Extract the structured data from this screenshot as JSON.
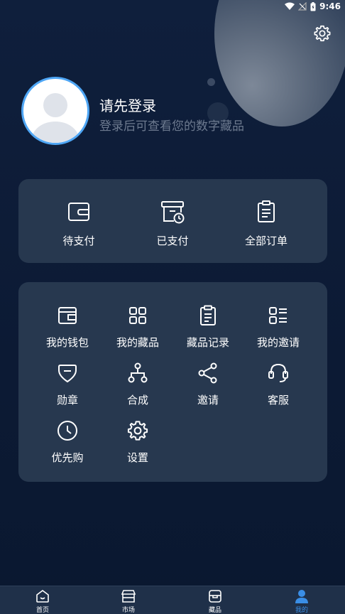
{
  "status_bar": {
    "time": "9:46"
  },
  "profile": {
    "login_title": "请先登录",
    "login_subtitle": "登录后可查看您的数字藏品"
  },
  "orders": [
    {
      "label": "待支付",
      "icon": "wallet-icon"
    },
    {
      "label": "已支付",
      "icon": "box-clock-icon"
    },
    {
      "label": "全部订单",
      "icon": "clipboard-icon"
    }
  ],
  "menu": [
    {
      "label": "我的钱包",
      "icon": "wallet-icon"
    },
    {
      "label": "我的藏品",
      "icon": "grid-icon"
    },
    {
      "label": "藏品记录",
      "icon": "clipboard-icon"
    },
    {
      "label": "我的邀请",
      "icon": "list-icon"
    },
    {
      "label": "勋章",
      "icon": "badge-icon"
    },
    {
      "label": "合成",
      "icon": "hierarchy-icon"
    },
    {
      "label": "邀请",
      "icon": "share-icon"
    },
    {
      "label": "客服",
      "icon": "headset-icon"
    },
    {
      "label": "优先购",
      "icon": "clock-icon"
    },
    {
      "label": "设置",
      "icon": "gear-icon"
    }
  ],
  "tabbar": [
    {
      "label": "首页",
      "icon": "home-icon"
    },
    {
      "label": "市场",
      "icon": "store-icon"
    },
    {
      "label": "藏品",
      "icon": "box-icon"
    },
    {
      "label": "我的",
      "icon": "user-icon",
      "active": true
    }
  ],
  "colors": {
    "accent": "#3a8ee6",
    "card": "#27384f",
    "background": "#0f1d38"
  }
}
